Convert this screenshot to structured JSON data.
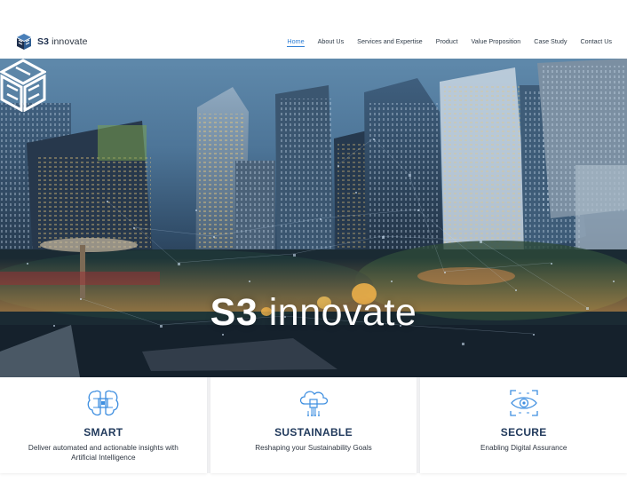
{
  "brand": {
    "name_bold": "S3",
    "name_rest": " innovate",
    "icon": "s3-cube-logo-icon",
    "accent": "#1e2f4d"
  },
  "nav": {
    "items": [
      {
        "label": "Home",
        "active": true
      },
      {
        "label": "About Us"
      },
      {
        "label": "Services and Expertise"
      },
      {
        "label": "Product"
      },
      {
        "label": "Value Proposition"
      },
      {
        "label": "Case Study"
      },
      {
        "label": "Contact Us"
      }
    ],
    "active_color": "#2f7fd6"
  },
  "hero": {
    "title_bold": "S3",
    "title_rest": " innovate",
    "logo_icon": "s3-cube-logo-icon"
  },
  "features": [
    {
      "icon": "brain-chip-icon",
      "title": "SMART",
      "description": "Deliver automated and actionable insights with Artificial Intelligence"
    },
    {
      "icon": "cloud-circuit-icon",
      "title": "SUSTAINABLE",
      "description": "Reshaping your Sustainability Goals"
    },
    {
      "icon": "eye-scan-icon",
      "title": "SECURE",
      "description": "Enabling Digital Assurance"
    }
  ],
  "colors": {
    "icon_blue": "#3f8fe0",
    "title_navy": "#213a5c"
  }
}
